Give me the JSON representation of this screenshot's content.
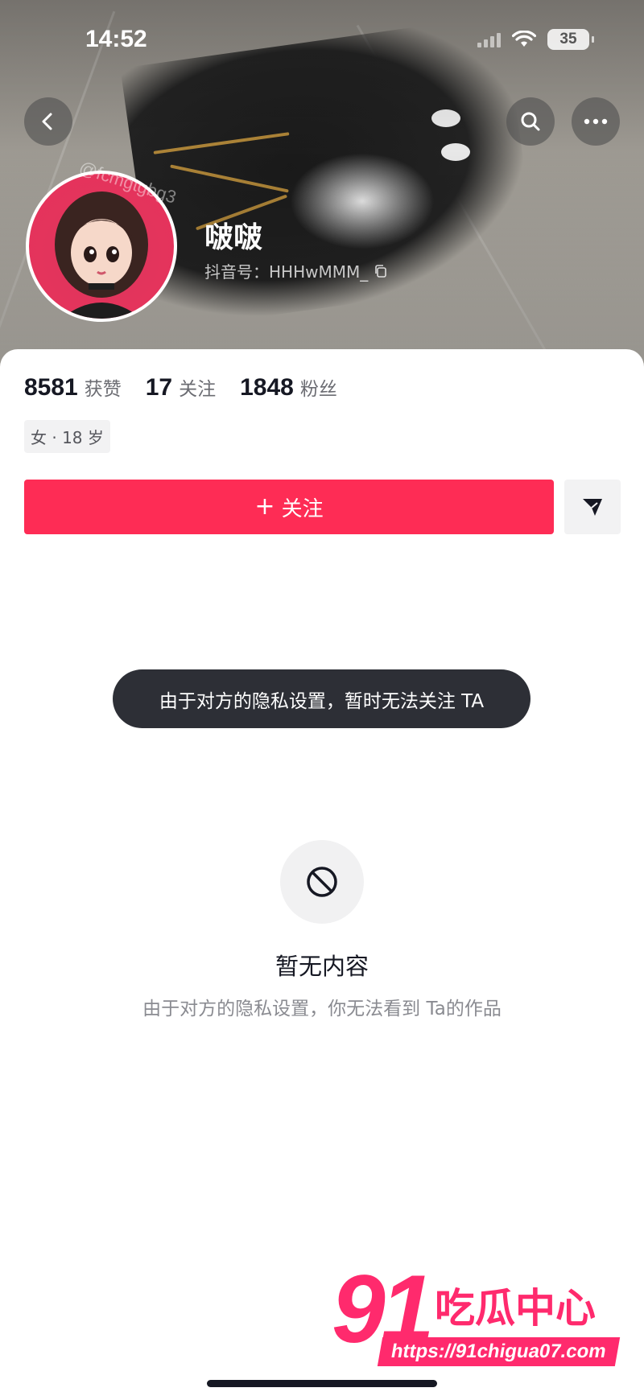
{
  "status_bar": {
    "time": "14:52",
    "battery": "35"
  },
  "profile": {
    "nickname": "啵啵",
    "douyin_id": "抖音号：HHHwMMM_",
    "stats": [
      {
        "value": "8581",
        "label": "获赞"
      },
      {
        "value": "17",
        "label": "关注"
      },
      {
        "value": "1848",
        "label": "粉丝"
      }
    ],
    "tag": "女 · 18 岁"
  },
  "actions": {
    "follow_label": "关注",
    "follow_plus": "+"
  },
  "toast": "由于对方的隐私设置，暂时无法关注 TA",
  "empty_state": {
    "title": "暂无内容",
    "description": "由于对方的隐私设置，你无法看到 Ta的作品"
  },
  "watermark": {
    "handle": "@fcmgtgbg3",
    "logo_number": "91",
    "logo_text": "吃瓜中心",
    "logo_url": "https://91chigua07.com"
  },
  "colors": {
    "accent": "#fe2c55",
    "toast_bg": "#2d2f36"
  },
  "icons": [
    "back-icon",
    "search-icon",
    "more-icon",
    "share-icon",
    "copy-icon",
    "forbidden-icon",
    "wifi-icon",
    "signal-icon"
  ]
}
